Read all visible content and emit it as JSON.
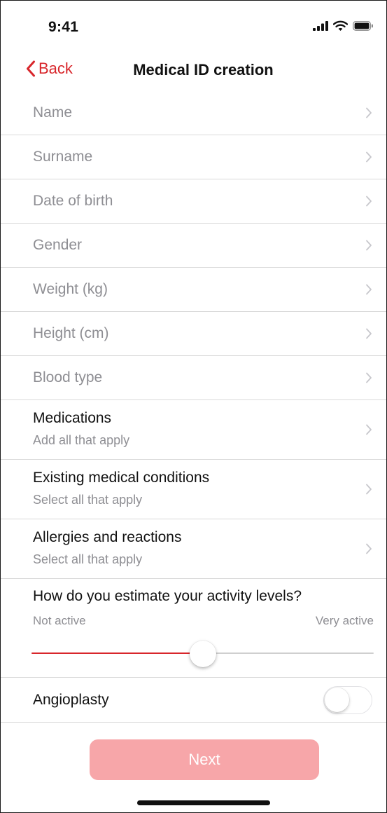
{
  "status_bar": {
    "time": "9:41",
    "icons": [
      "signal-icon",
      "wifi-icon",
      "battery-icon"
    ]
  },
  "nav": {
    "back_label": "Back",
    "title": "Medical ID creation"
  },
  "fields": [
    {
      "label": "Name"
    },
    {
      "label": "Surname"
    },
    {
      "label": "Date of birth"
    },
    {
      "label": "Gender"
    },
    {
      "label": "Weight (kg)"
    },
    {
      "label": "Height (cm)"
    },
    {
      "label": "Blood type"
    }
  ],
  "multi_fields": [
    {
      "title": "Medications",
      "subtitle": "Add all that apply"
    },
    {
      "title": "Existing medical conditions",
      "subtitle": "Select all that apply"
    },
    {
      "title": "Allergies and reactions",
      "subtitle": "Select all that apply"
    }
  ],
  "activity": {
    "question": "How do you estimate your activity levels?",
    "min_label": "Not active",
    "max_label": "Very active",
    "value": 0.5
  },
  "angioplasty": {
    "label": "Angioplasty",
    "enabled": false
  },
  "next_label": "Next",
  "colors": {
    "accent": "#d8262b",
    "next_button": "#f7a6a9",
    "secondary_text": "#8e8e93",
    "separator": "#d9d9d9"
  }
}
